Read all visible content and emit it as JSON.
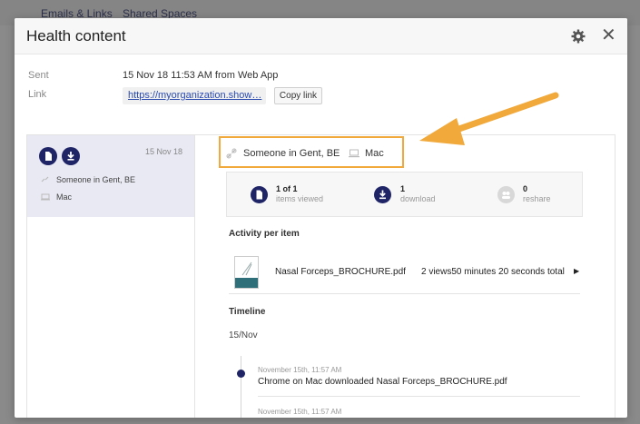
{
  "background": {
    "tabs": [
      "Emails & Links",
      "Shared Spaces"
    ]
  },
  "modal": {
    "title": "Health content",
    "sent_label": "Sent",
    "sent_value": "15 Nov 18 11:53 AM from Web App",
    "link_label": "Link",
    "link_value": "https://myorganization.show…",
    "copy_link_label": "Copy link"
  },
  "session": {
    "date": "15 Nov 18",
    "location": "Someone in Gent, BE",
    "device": "Mac"
  },
  "details": {
    "location": "Someone in Gent, BE",
    "device": "Mac",
    "stats": {
      "viewed_num": "1 of 1",
      "viewed_label": "items viewed",
      "download_num": "1",
      "download_label": "download",
      "reshare_num": "0",
      "reshare_label": "reshare"
    },
    "activity_title": "Activity per item",
    "item_name": "Nasal Forceps_BROCHURE.pdf",
    "item_stats": "2 views50 minutes 20 seconds total",
    "timeline_title": "Timeline",
    "timeline_date": "15/Nov",
    "events": [
      {
        "time": "November 15th, 11:57 AM",
        "text": "Chrome on Mac downloaded Nasal Forceps_BROCHURE.pdf"
      },
      {
        "time": "November 15th, 11:57 AM"
      }
    ]
  },
  "colors": {
    "accent": "#1e2466",
    "highlight": "#f0a93a",
    "session_bg": "#e8e9f3"
  },
  "icons": [
    "gear-icon",
    "close-icon",
    "document-icon",
    "download-icon",
    "link-icon",
    "laptop-icon",
    "reshare-icon"
  ]
}
